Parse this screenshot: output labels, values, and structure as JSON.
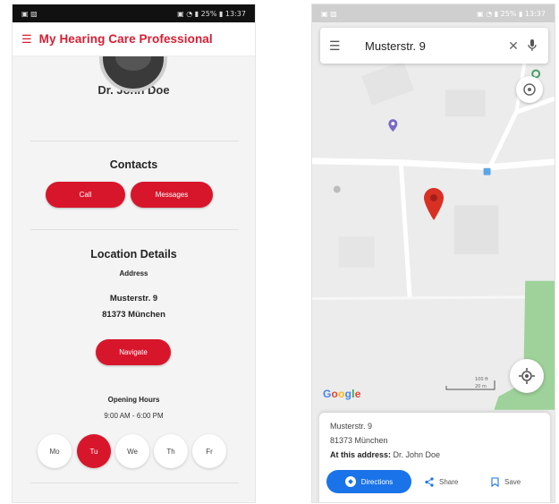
{
  "left_app": {
    "status_left": "▣ ▨",
    "status_right": "▣ ◔ ▮ 25% ▮ 13:37",
    "menu_icon": "hamburger-menu-icon",
    "title": "My Hearing Care Professional",
    "doctor_name": "Dr. John Doe",
    "contacts": {
      "heading": "Contacts",
      "call_label": "Call",
      "message_label": "Messages"
    },
    "location": {
      "heading": "Location Details",
      "address_label": "Address",
      "street": "Musterstr. 9",
      "city": "81373 München",
      "navigate_label": "Navigate",
      "hours_label": "Opening Hours",
      "hours": "9:00 AM - 6:00 PM"
    },
    "days": [
      "Mo",
      "Tu",
      "We",
      "Th",
      "Fr"
    ],
    "active_day": "Tu",
    "accent_color": "#d8162b"
  },
  "right_app": {
    "status_left": "▣ ▨",
    "status_right": "▣ ◔ ▮ 25% ▮ 13:37",
    "search_query": "Musterstr. 9",
    "google_logo": "Google",
    "card": {
      "street": "Musterstr. 9",
      "city": "81373 München",
      "at_address_label": "At this address:",
      "at_address_value": "Dr. John Doe",
      "directions_label": "Directions",
      "share_label": "Share",
      "save_label": "Save"
    },
    "accent_color": "#1a73e8"
  }
}
